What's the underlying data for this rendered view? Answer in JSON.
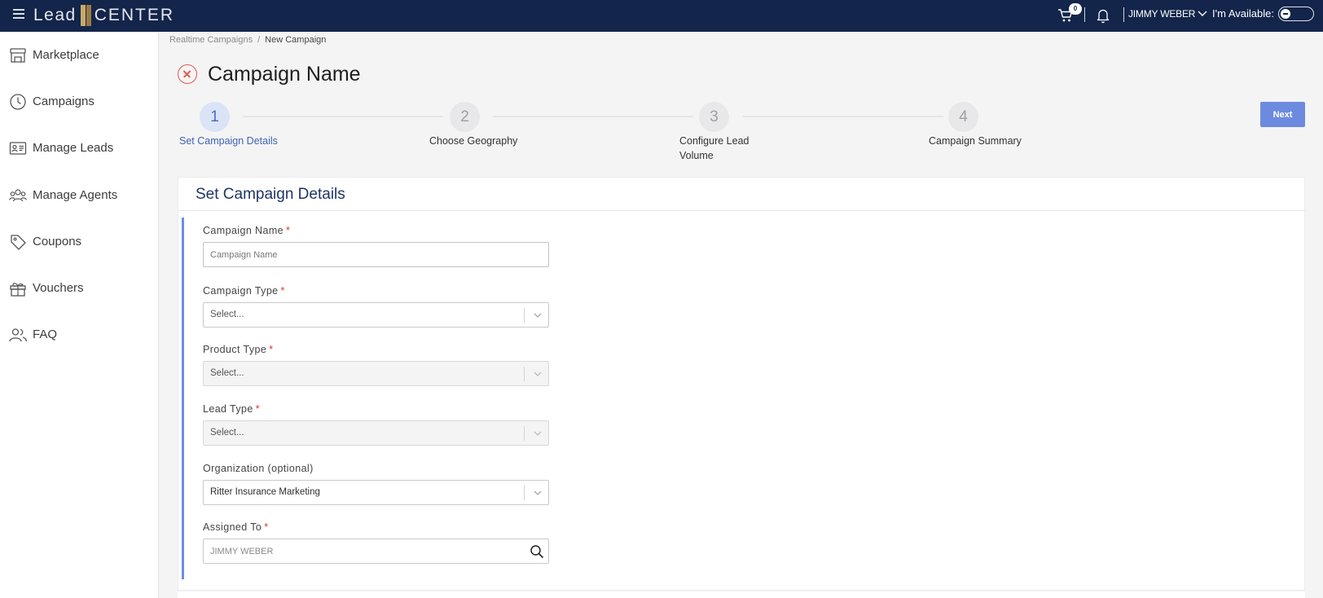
{
  "topbar": {
    "logo_lead": "Lead",
    "logo_center": "CENTER",
    "cart_count": "0",
    "user_name": "JIMMY WEBER",
    "availability_label": "I'm Available:"
  },
  "sidebar": {
    "items": [
      {
        "label": "Marketplace",
        "icon": "store-icon"
      },
      {
        "label": "Campaigns",
        "icon": "clock-icon"
      },
      {
        "label": "Manage Leads",
        "icon": "id-card-icon"
      },
      {
        "label": "Manage Agents",
        "icon": "agents-icon"
      },
      {
        "label": "Coupons",
        "icon": "tag-icon"
      },
      {
        "label": "Vouchers",
        "icon": "gift-icon"
      },
      {
        "label": "FAQ",
        "icon": "users-icon"
      }
    ]
  },
  "breadcrumb": {
    "parent": "Realtime Campaigns",
    "separator": "/",
    "current": "New Campaign"
  },
  "page": {
    "title": "Campaign Name"
  },
  "stepper": {
    "steps": [
      {
        "number": "1",
        "label": "Set Campaign Details",
        "active": true
      },
      {
        "number": "2",
        "label": "Choose Geography",
        "active": false
      },
      {
        "number": "3",
        "label_line1": "Configure Lead",
        "label_line2": "Volume",
        "active": false
      },
      {
        "number": "4",
        "label": "Campaign Summary",
        "active": false
      }
    ],
    "next_label": "Next"
  },
  "form": {
    "section_title": "Set Campaign Details",
    "campaign_name": {
      "label": "Campaign Name",
      "placeholder": "Campaign Name",
      "required": "*"
    },
    "campaign_type": {
      "label": "Campaign Type",
      "value": "Select...",
      "required": "*"
    },
    "product_type": {
      "label": "Product Type",
      "value": "Select...",
      "required": "*"
    },
    "lead_type": {
      "label": "Lead Type",
      "value": "Select...",
      "required": "*"
    },
    "organization": {
      "label": "Organization (optional)",
      "value": "Ritter Insurance Marketing"
    },
    "assigned_to": {
      "label": "Assigned To",
      "value": "JIMMY WEBER",
      "required": "*"
    }
  },
  "colors": {
    "topbar": "#13254a",
    "accent": "#6b8de3",
    "active_step": "#3e63b2",
    "required": "#d9362b",
    "close": "#e0584e"
  }
}
